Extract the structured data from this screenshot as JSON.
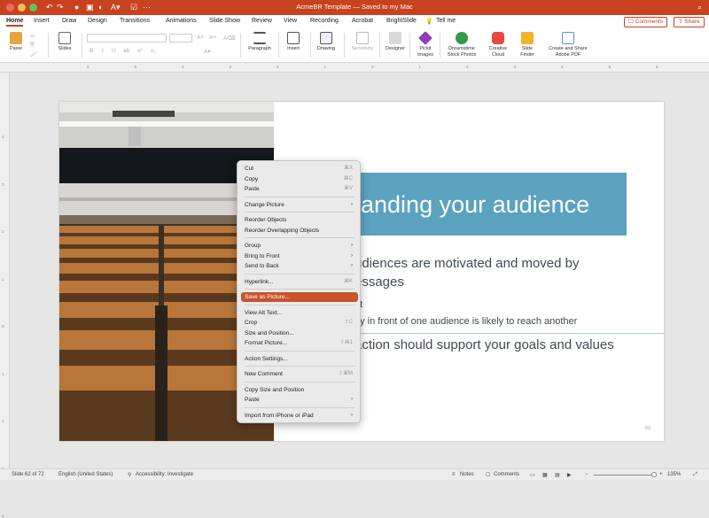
{
  "titlebar": {
    "doc_title": "AcmeBR Template — Saved to my Mac",
    "search_icon": "search-icon"
  },
  "tabs": [
    {
      "label": "Home",
      "selected": true
    },
    {
      "label": "Insert"
    },
    {
      "label": "Draw"
    },
    {
      "label": "Design"
    },
    {
      "label": "Transitions"
    },
    {
      "label": "Animations"
    },
    {
      "label": "Slide Show"
    },
    {
      "label": "Review"
    },
    {
      "label": "View"
    },
    {
      "label": "Recording"
    },
    {
      "label": "Acrobat"
    },
    {
      "label": "BrightSlide"
    },
    {
      "label": "Tell me"
    }
  ],
  "top_buttons": {
    "comments": "Comments",
    "share": "Share"
  },
  "ribbon": {
    "paste": "Paste",
    "slides": "Slides",
    "paragraph": "Paragraph",
    "insert": "Insert",
    "drawing": "Drawing",
    "sensitivity": "Sensitivity",
    "designer": "Designer",
    "pickit": "Pickit Images",
    "dreamstime": "Dreamstime Stock Photos",
    "creative_cloud": "Creative Cloud",
    "slide_finder": "Slide Finder",
    "create_share_pdf": "Create and Share Adobe PDF"
  },
  "ruler": {
    "h": [
      "6",
      "5",
      "4",
      "3",
      "2",
      "1",
      "0",
      "1",
      "2",
      "3",
      "4",
      "5",
      "6"
    ],
    "v": [
      "4",
      "3",
      "2",
      "1",
      "0",
      "1",
      "2",
      "3",
      "4"
    ]
  },
  "slide": {
    "title": "anding your audience",
    "line1": "udiences are motivated and moved by",
    "line2": "essages",
    "line3": "nt",
    "line4": "ay in front of one audience is likely to reach another",
    "line5": "action should support your goals and values",
    "slide_number": "62"
  },
  "menu": {
    "items": [
      {
        "label": "Cut",
        "shortcut": "⌘X"
      },
      {
        "label": "Copy",
        "shortcut": "⌘C"
      },
      {
        "label": "Paste",
        "shortcut": "⌘V"
      },
      {
        "sep": true
      },
      {
        "label": "Change Picture",
        "shortcut": "›"
      },
      {
        "sep": true
      },
      {
        "label": "Reorder Objects",
        "shortcut": ""
      },
      {
        "label": "Reorder Overlapping Objects",
        "shortcut": ""
      },
      {
        "sep": true
      },
      {
        "label": "Group",
        "shortcut": "›"
      },
      {
        "label": "Bring to Front",
        "shortcut": "›"
      },
      {
        "label": "Send to Back",
        "shortcut": "›"
      },
      {
        "sep": true
      },
      {
        "label": "Hyperlink...",
        "shortcut": "⌘K"
      },
      {
        "sep": true
      },
      {
        "label": "Save as Picture...",
        "shortcut": "",
        "highlighted": true
      },
      {
        "sep": true
      },
      {
        "label": "View Alt Text...",
        "shortcut": ""
      },
      {
        "label": "Crop",
        "shortcut": "⇧C"
      },
      {
        "label": "Size and Position...",
        "shortcut": ""
      },
      {
        "label": "Format Picture...",
        "shortcut": "⇧⌘1"
      },
      {
        "sep": true
      },
      {
        "label": "Action Settings...",
        "shortcut": ""
      },
      {
        "sep": true
      },
      {
        "label": "New Comment",
        "shortcut": "⇧⌘M"
      },
      {
        "sep": true
      },
      {
        "label": "Copy Size and Position",
        "shortcut": ""
      },
      {
        "label": "Paste",
        "shortcut": "›"
      },
      {
        "sep": true
      },
      {
        "label": "Import from iPhone or iPad",
        "shortcut": "›"
      }
    ]
  },
  "status": {
    "slide": "Slide 62 of 72",
    "language": "English (United States)",
    "accessibility": "Accessibility: Investigate",
    "notes": "Notes",
    "comments": "Comments",
    "zoom": "135%"
  },
  "colors": {
    "accent": "#c8421f",
    "banner": "#5ba2bf",
    "menu_highlight": "#c8532d"
  }
}
